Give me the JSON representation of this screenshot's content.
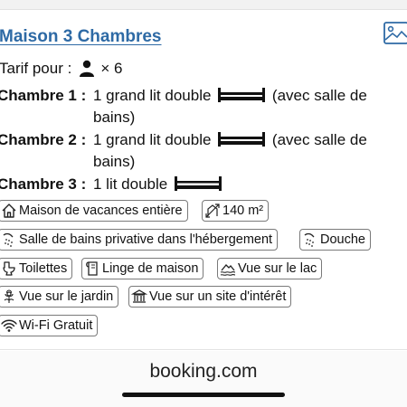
{
  "title": "Maison 3 Chambres",
  "photo_icon": "image-icon",
  "tarif": {
    "label": "Tarif pour :",
    "icon": "person-icon",
    "multiplier": "× 6"
  },
  "bedrooms": [
    {
      "label": "Chambre 1 :",
      "pre": "1 grand lit double",
      "icon": "double-bed-icon",
      "post": "(avec salle de bains)"
    },
    {
      "label": "Chambre 2 :",
      "pre": "1 grand lit double",
      "icon": "double-bed-icon",
      "post": "(avec salle de bains)"
    },
    {
      "label": "Chambre 3 :",
      "pre": "1 lit double",
      "icon": "bed-icon",
      "post": ""
    }
  ],
  "facilities": [
    {
      "label": "Maison de vacances entière",
      "icon": "house-icon"
    },
    {
      "label": "140 m²",
      "icon": "area-icon"
    },
    {
      "label": "Salle de bains privative dans l'hébergement",
      "icon": "shower-icon"
    },
    {
      "label": "Douche",
      "icon": "shower-icon"
    },
    {
      "label": "Toilettes",
      "icon": "toilet-icon"
    },
    {
      "label": "Linge de maison",
      "icon": "linen-icon"
    },
    {
      "label": "Vue sur le lac",
      "icon": "lake-view-icon"
    },
    {
      "label": "Vue sur le jardin",
      "icon": "garden-icon"
    },
    {
      "label": "Vue sur un site d'intérêt",
      "icon": "landmark-icon"
    },
    {
      "label": "Wi-Fi Gratuit",
      "icon": "wifi-icon"
    }
  ],
  "browser": {
    "url": "booking.com"
  },
  "colors": {
    "link": "#2e6aa5",
    "chip_border": "#7a7a7a",
    "text": "#111111"
  }
}
